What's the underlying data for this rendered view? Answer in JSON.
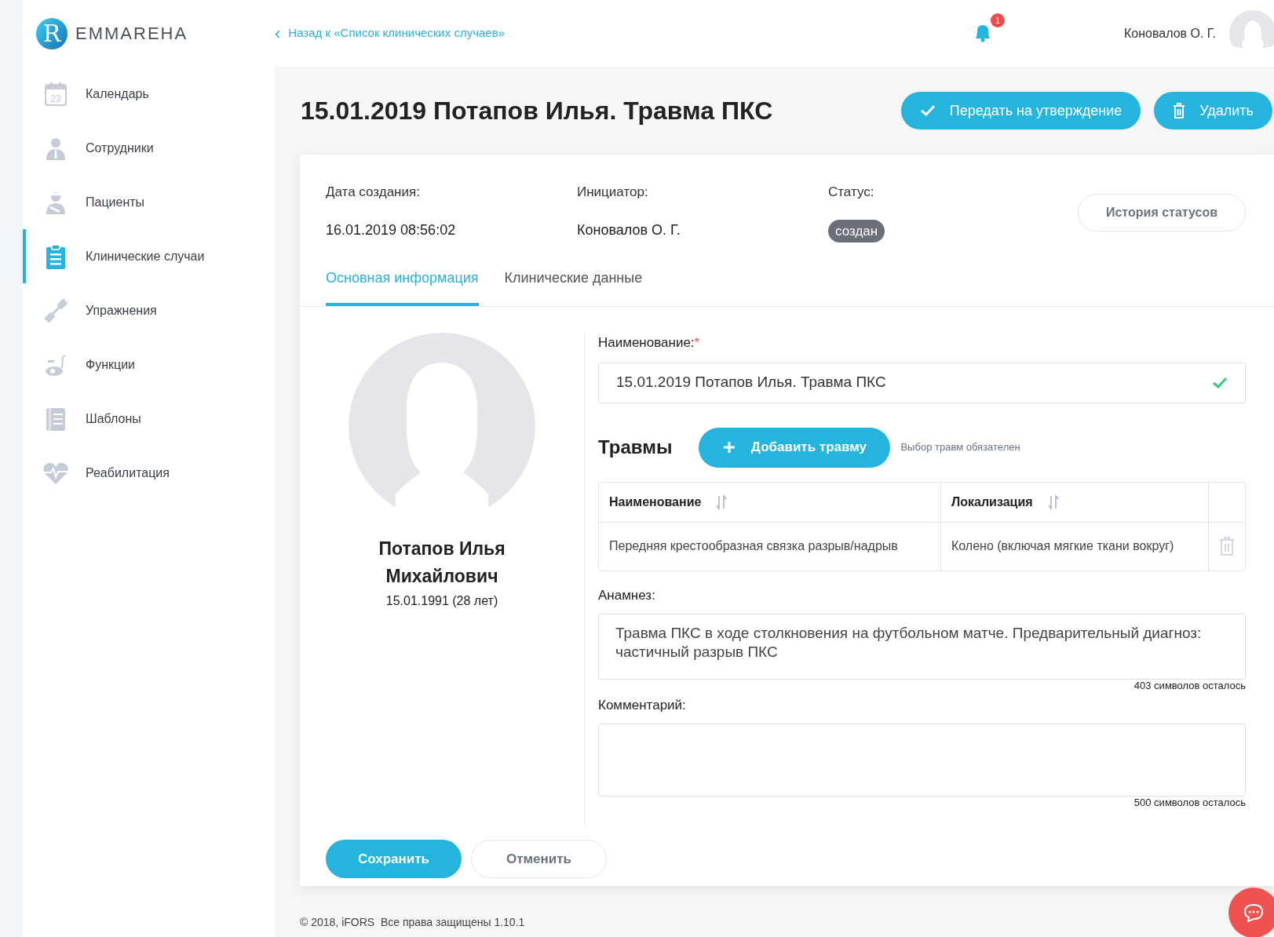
{
  "brand": {
    "name": "EMMAREHA",
    "logo_letter": "R"
  },
  "header": {
    "back_link": "‹",
    "back_text": "Назад к «Список клинических случаев»",
    "notifications": "1",
    "user": "Коновалов О. Г."
  },
  "sidebar": {
    "items": [
      {
        "label": "Календарь",
        "kind": "calendar",
        "selected": false,
        "calendar_day": "23"
      },
      {
        "label": "Сотрудники",
        "kind": "staff",
        "selected": false
      },
      {
        "label": "Пациенты",
        "kind": "patient",
        "selected": false
      },
      {
        "label": "Клинические случаи",
        "kind": "clipboard",
        "selected": true
      },
      {
        "label": "Упражнения",
        "kind": "dumbbell",
        "selected": false
      },
      {
        "label": "Функции",
        "kind": "bike",
        "selected": false
      },
      {
        "label": "Шаблоны",
        "kind": "document",
        "selected": false
      },
      {
        "label": "Реабилитация",
        "kind": "heart",
        "selected": false
      }
    ]
  },
  "page": {
    "title": "15.01.2019 Потапов Илья. Травма ПКС",
    "actions": [
      {
        "label": "Передать на утверждение",
        "kind": "approve"
      },
      {
        "label": "Удалить",
        "kind": "delete"
      }
    ]
  },
  "meta": [
    {
      "label": "Дата создания:",
      "value": "16.01.2019 08:56:02",
      "kind": "text"
    },
    {
      "label": "Инициатор:",
      "value": "Коновалов О. Г.",
      "kind": "text"
    },
    {
      "label": "Статус:",
      "value": "создан",
      "kind": "badge"
    }
  ],
  "status_history_button": "История статусов",
  "tabs": [
    {
      "label": "Основная информация",
      "selected": true
    },
    {
      "label": "Клинические данные",
      "selected": false
    }
  ],
  "patient": {
    "name_line_1": "Потапов Илья",
    "name_line_2": "Михайлович",
    "birth": "15.01.1991 (28 лет)"
  },
  "form": {
    "name_label": "Наименование:",
    "required_mark": "*",
    "name_value": "15.01.2019 Потапов Илья. Травма ПКС",
    "name_valid": true,
    "injuries_title": "Травмы",
    "add_injury": "Добавить травму",
    "injuries_hint": "Выбор травм обязателен",
    "table": {
      "columns": [
        "Наименование",
        "Локализация"
      ],
      "rows": [
        [
          "Передняя крестообразная связка разрыв/надрыв",
          "Колено (включая мягкие ткани вокруг)"
        ]
      ]
    },
    "anamnesis_label": "Анамнез:",
    "anamnesis_value": "Травма ПКС в ходе столкновения на футбольном матче. Предварительный диагноз: частичный разрыв ПКС",
    "anamnesis_counter": "403 символов осталось",
    "comment_label": "Комментарий:",
    "comment_counter": "500 символов осталось"
  },
  "buttons": {
    "save": "Сохранить",
    "cancel": "Отменить"
  },
  "footer": "© 2018, iFORS  Все права защищены 1.10.1"
}
